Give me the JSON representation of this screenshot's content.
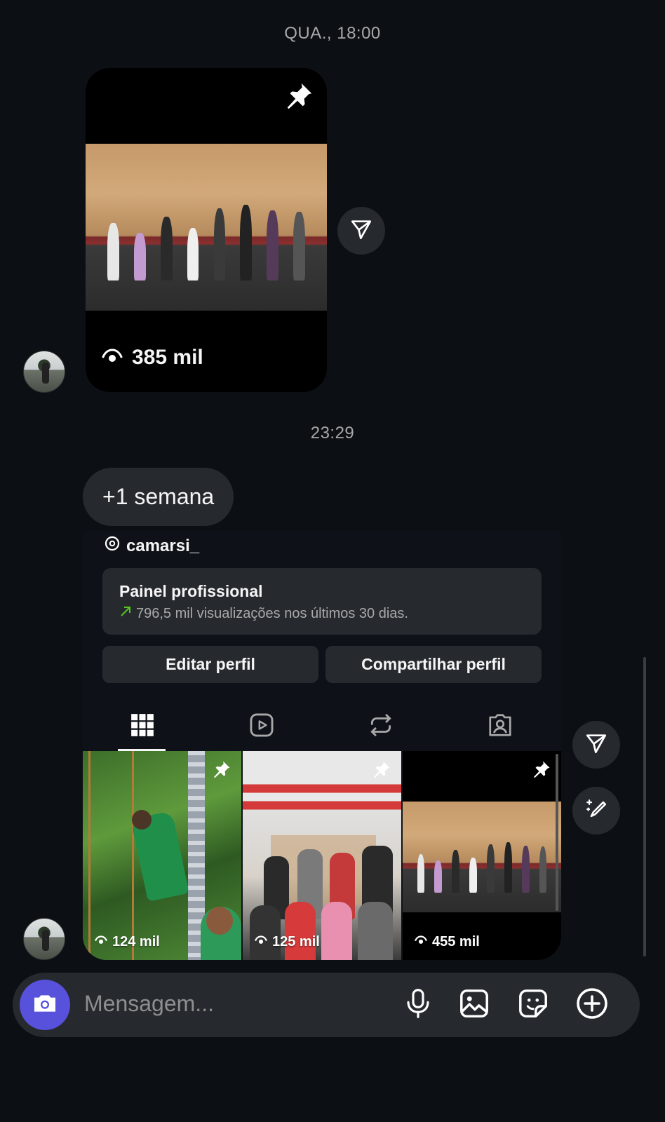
{
  "thread": {
    "timestamp_1": "QUA., 18:00",
    "timestamp_2": "23:29"
  },
  "reel_message": {
    "views": "385 mil"
  },
  "text_message": {
    "text": "+1 semana"
  },
  "profile_share": {
    "username": "camarsi_",
    "dashboard_title": "Painel profissional",
    "dashboard_stat": "796,5 mil visualizações nos últimos 30 dias.",
    "edit_button": "Editar perfil",
    "share_button": "Compartilhar perfil",
    "tabs": [
      "grid-icon",
      "reels-icon",
      "reposts-icon",
      "tagged-icon"
    ],
    "posts": [
      {
        "views": "124 mil",
        "pinned": true
      },
      {
        "views": "125 mil",
        "pinned": true
      },
      {
        "views": "455 mil",
        "pinned": true
      }
    ]
  },
  "composer": {
    "placeholder": "Mensagem...",
    "icons": [
      "camera-icon",
      "microphone-icon",
      "gallery-icon",
      "sticker-icon",
      "plus-icon"
    ]
  },
  "colors": {
    "background": "#0c1014",
    "bubble": "#262a2f",
    "camera_button": "#5851db",
    "trend_arrow": "#58c322"
  }
}
